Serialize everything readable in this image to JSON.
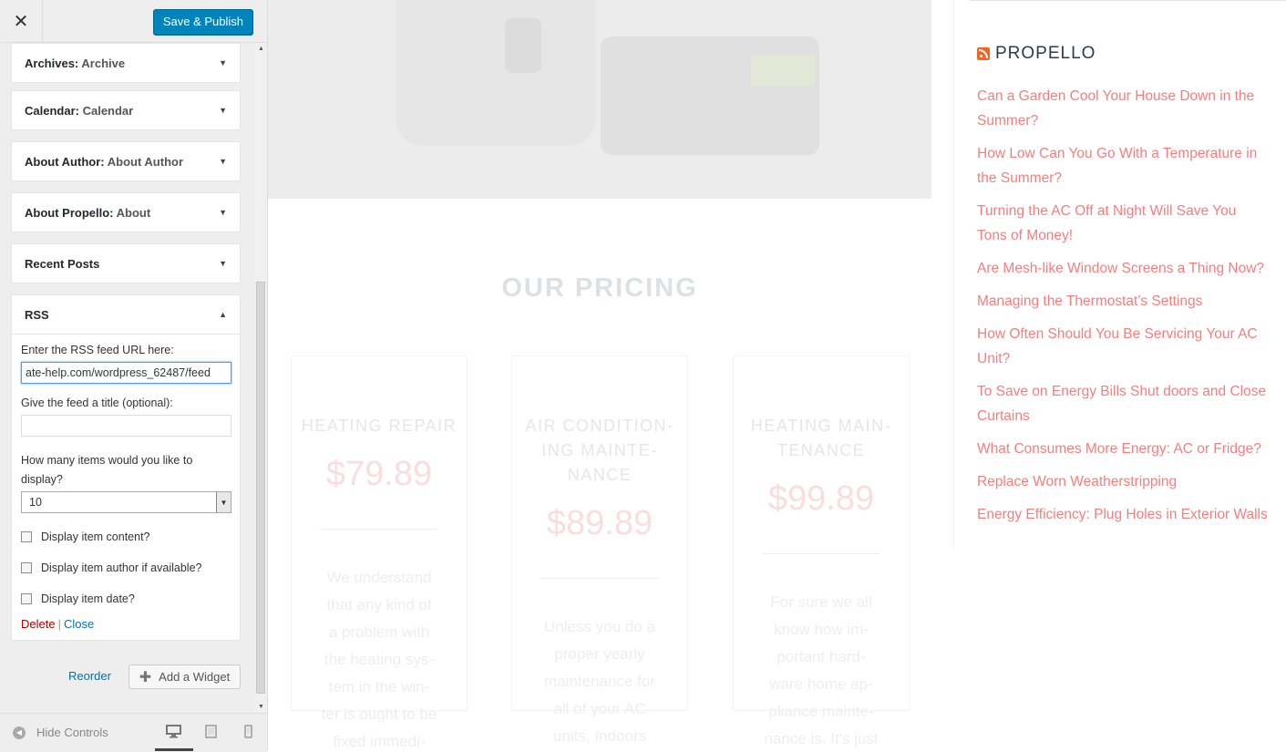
{
  "topbar": {
    "close_icon": "close-icon",
    "close_glyph": "✕",
    "save_label": "Save & Publish"
  },
  "widgets": [
    {
      "title": "Archives",
      "subtitle": "Archive"
    },
    {
      "title": "Calendar",
      "subtitle": "Calendar"
    },
    {
      "title": "About Author",
      "subtitle": "About Author"
    },
    {
      "title": "About Propello",
      "subtitle": "About"
    },
    {
      "title": "Recent Posts",
      "subtitle": ""
    }
  ],
  "rss_widget": {
    "title": "RSS",
    "url_label": "Enter the RSS feed URL here:",
    "url_value": "ate-help.com/wordpress_62487/feed",
    "title_label": "Give the feed a title (optional):",
    "title_value": "",
    "items_label": "How many items would you like to display?",
    "items_value": "10",
    "show_content_label": "Display item content?",
    "show_author_label": "Display item author if available?",
    "show_date_label": "Display item date?",
    "delete_label": "Delete",
    "separator": "|",
    "close_label": "Close"
  },
  "footer_actions": {
    "reorder_label": "Reorder",
    "add_widget_label": "Add a Widget",
    "add_icon": "plus-icon"
  },
  "bottombar": {
    "hide_controls_label": "Hide Controls",
    "devices": [
      "desktop-icon",
      "tablet-icon",
      "mobile-icon"
    ],
    "active_device": "desktop"
  },
  "preview": {
    "pricing_title": "OUR PRICING",
    "cards": [
      {
        "title": "HEATING REPAIR",
        "price": "$79.89",
        "text": "We understand that any kind of a problem with the heating sys- tem in the win- ter is ought to be fixed immedi-"
      },
      {
        "title": "AIR CONDITION- ING MAINTE- NANCE",
        "price": "$89.89",
        "text": "Unless you do a proper yearly maintenance for all of your AC units, Indoors"
      },
      {
        "title": "HEATING MAIN- TENANCE",
        "price": "$99.89",
        "text": "For sure we all know how im- portant hard- ware home ap- pliance mainte- nance is. It's just"
      }
    ],
    "rss_heading": "PROPELLO",
    "rss_items": [
      "Can a Garden Cool Your House Down in the Summer?",
      "How Low Can You Go With a Temperature in the Summer?",
      "Turning the AC Off at Night Will Save You Tons of Money!",
      "Are Mesh-like Window Screens a Thing Now?",
      "Managing the Thermostat's Settings",
      "How Often Should You Be Servicing Your AC Unit?",
      "To Save on Energy Bills Shut doors and Close Curtains",
      "What Consumes More Energy: AC or Fridge?",
      "Replace Worn Weatherstripping",
      "Energy Efficiency: Plug Holes in Exterior Walls"
    ]
  },
  "colors": {
    "primary_button": "#0085ba",
    "link": "#0073aa",
    "delete": "#aa0000",
    "rss_link": "#f08080",
    "rss_icon": "#f26522"
  }
}
